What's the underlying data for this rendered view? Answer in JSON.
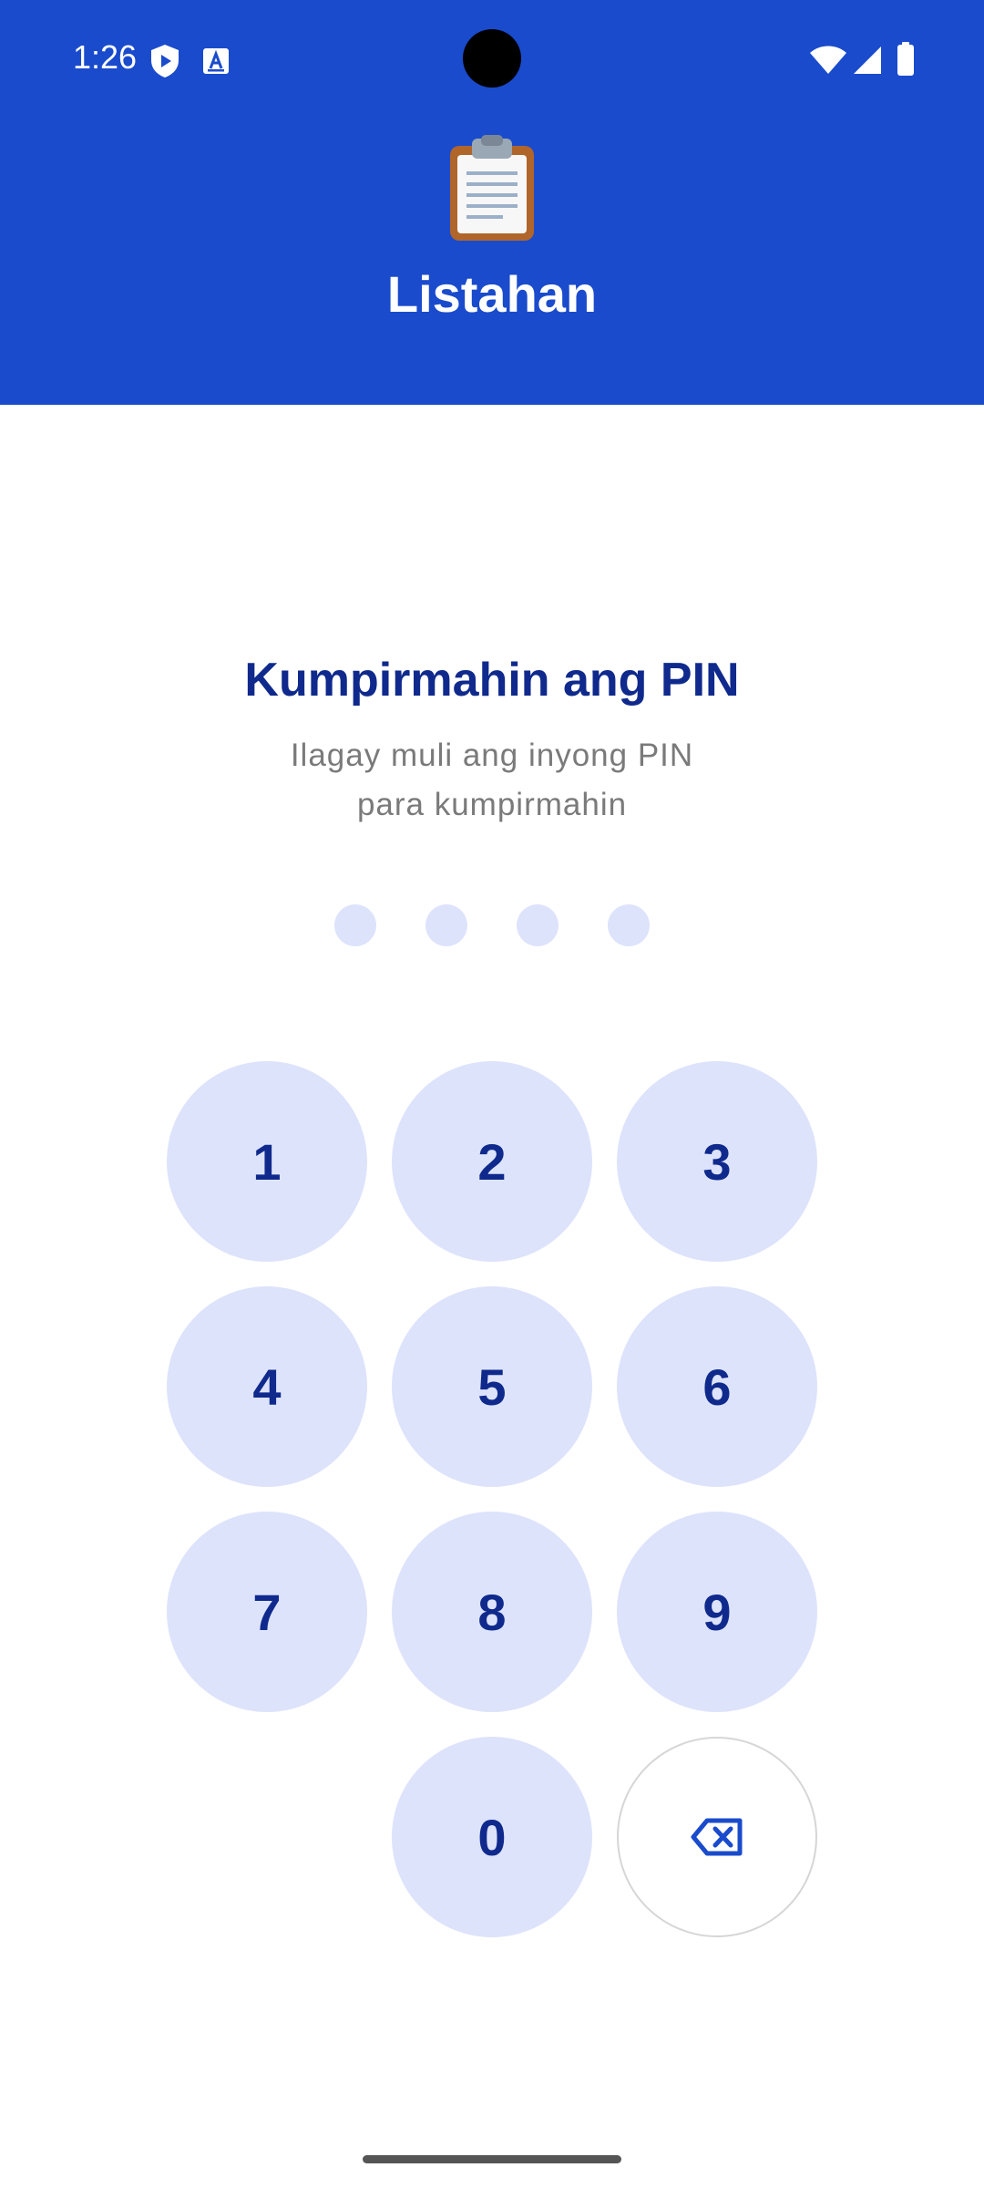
{
  "status_bar": {
    "time": "1:26",
    "icons": [
      "shield-play-icon",
      "translate-a-icon",
      "wifi-icon",
      "signal-icon",
      "battery-icon"
    ]
  },
  "header": {
    "logo_icon": "clipboard-icon",
    "title": "Listahan",
    "background_color": "#1a4bcc"
  },
  "prompt": {
    "title": "Kumpirmahin ang PIN",
    "subtitle_line1": "Ilagay muli ang inyong PIN",
    "subtitle_line2": "para kumpirmahin"
  },
  "pin": {
    "length": 4,
    "filled": 0
  },
  "keypad": {
    "keys": [
      "1",
      "2",
      "3",
      "4",
      "5",
      "6",
      "7",
      "8",
      "9",
      "0"
    ],
    "backspace_icon": "backspace-icon"
  },
  "colors": {
    "accent": "#1a4bcc",
    "key_bg": "#dde3fb",
    "key_text": "#0f2a8c",
    "subtitle": "#7a7a7a"
  }
}
